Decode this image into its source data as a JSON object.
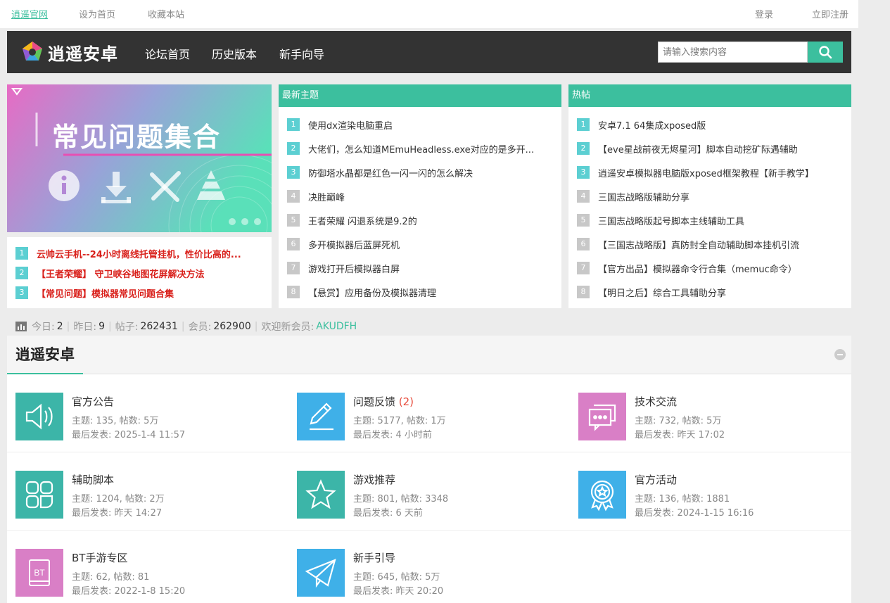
{
  "topbar": {
    "links": [
      "逍遥官网",
      "设为首页",
      "收藏本站"
    ],
    "login": "登录",
    "register": "立即注册"
  },
  "header": {
    "logo_text": "逍遥安卓",
    "nav": [
      "论坛首页",
      "历史版本",
      "新手向导"
    ],
    "search_placeholder": "请输入搜索内容"
  },
  "banner": {
    "title": "常见问题集合"
  },
  "pinned": [
    {
      "num": "1",
      "text": "云帅云手机--24小时离线托管挂机，性价比高的..."
    },
    {
      "num": "2",
      "text": "【王者荣耀】 守卫峡谷地图花屏解决方法"
    },
    {
      "num": "3",
      "text": "【常见问题】模拟器常见问题合集"
    }
  ],
  "latest": {
    "title": "最新主题",
    "items": [
      {
        "num": "1",
        "text": "使用dx渲染电脑重启"
      },
      {
        "num": "2",
        "text": "大佬们，怎么知道MEmuHeadless.exe对应的是多开..."
      },
      {
        "num": "3",
        "text": "防御塔水晶都是红色一闪一闪的怎么解决"
      },
      {
        "num": "4",
        "text": "决胜巅峰"
      },
      {
        "num": "5",
        "text": "王者荣耀 闪退系统是9.2的"
      },
      {
        "num": "6",
        "text": "多开模拟器后蓝屏死机"
      },
      {
        "num": "7",
        "text": "游戏打开后模拟器白屏"
      },
      {
        "num": "8",
        "text": "【悬赏】应用备份及模拟器清理"
      }
    ]
  },
  "hot": {
    "title": "热帖",
    "items": [
      {
        "num": "1",
        "text": "安卓7.1 64集成xposed版"
      },
      {
        "num": "2",
        "text": "【eve星战前夜无烬星河】脚本自动挖矿际遇辅助"
      },
      {
        "num": "3",
        "text": "逍遥安卓模拟器电脑版xposed框架教程【新手教学】"
      },
      {
        "num": "4",
        "text": "三国志战略版辅助分享"
      },
      {
        "num": "5",
        "text": "三国志战略版起号脚本主线辅助工具"
      },
      {
        "num": "6",
        "text": "【三国志战略版】真防封全自动辅助脚本挂机引流"
      },
      {
        "num": "7",
        "text": "【官方出品】模拟器命令行合集（memuc命令）"
      },
      {
        "num": "8",
        "text": "【明日之后】综合工具辅助分享"
      }
    ]
  },
  "stats": {
    "today_label": "今日:",
    "today": "2",
    "yesterday_label": "昨日:",
    "yesterday": "9",
    "posts_label": "帖子:",
    "posts": "262431",
    "members_label": "会员:",
    "members": "262900",
    "welcome_label": "欢迎新会员:",
    "new_member": "AKUDFH"
  },
  "forum": {
    "title": "逍遥安卓",
    "boards": [
      {
        "name": "官方公告",
        "new": "",
        "stat": "主题: 135, 帖数: 5万",
        "last": "最后发表: 2025-1-4 11:57",
        "color": "#3cb5a8",
        "icon": "speaker-icon"
      },
      {
        "name": "问题反馈",
        "new": " (2)",
        "stat": "主题: 5177, 帖数: 1万",
        "last": "最后发表: 4 小时前",
        "color": "#3fb0e8",
        "icon": "pencil-icon"
      },
      {
        "name": "技术交流",
        "new": "",
        "stat": "主题: 732, 帖数: 5万",
        "last": "最后发表: 昨天 17:02",
        "color": "#d97fc6",
        "icon": "chat-icon"
      },
      {
        "name": "辅助脚本",
        "new": "",
        "stat": "主题: 1204, 帖数: 2万",
        "last": "最后发表: 昨天 14:27",
        "color": "#3cb5a8",
        "icon": "grid-icon"
      },
      {
        "name": "游戏推荐",
        "new": "",
        "stat": "主题: 801, 帖数: 3348",
        "last": "最后发表: 6 天前",
        "color": "#3cb5a8",
        "icon": "star-icon"
      },
      {
        "name": "官方活动",
        "new": "",
        "stat": "主题: 136, 帖数: 1881",
        "last": "最后发表: 2024-1-15 16:16",
        "color": "#3fb0e8",
        "icon": "award-icon"
      },
      {
        "name": "BT手游专区",
        "new": "",
        "stat": "主题: 62, 帖数: 81",
        "last": "最后发表: 2022-1-8 15:20",
        "color": "#d97fc6",
        "icon": "bt-book-icon"
      },
      {
        "name": "新手引导",
        "new": "",
        "stat": "主题: 645, 帖数: 5万",
        "last": "最后发表: 昨天 20:20",
        "color": "#3fb0e8",
        "icon": "paper-plane-icon"
      }
    ],
    "bt_label": "BT"
  }
}
